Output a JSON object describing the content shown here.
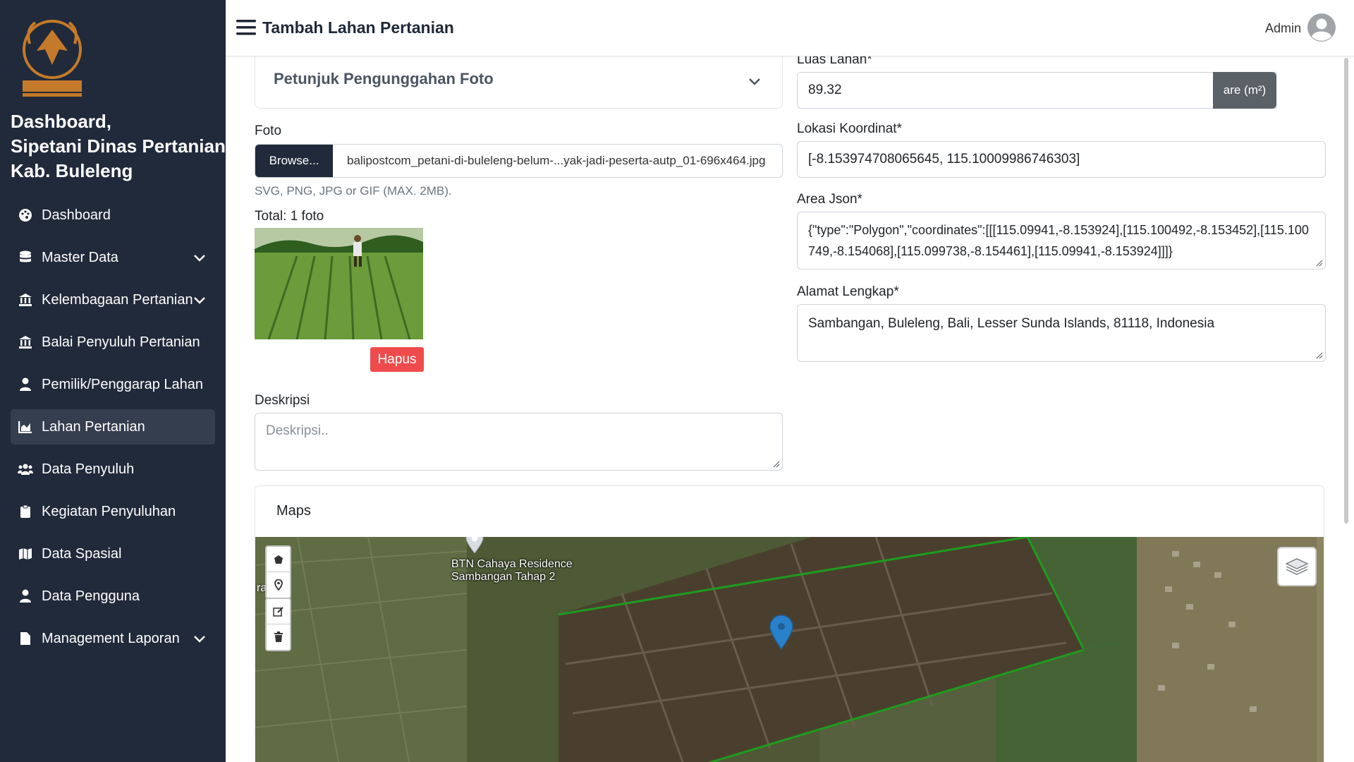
{
  "sidebar": {
    "brand_line1": "Dashboard,",
    "brand_line2": "Sipetani Dinas Pertanian",
    "brand_line3": "Kab. Buleleng",
    "items": [
      {
        "label": "Dashboard",
        "icon": "palette-icon"
      },
      {
        "label": "Master Data",
        "icon": "database-icon",
        "expandable": true
      },
      {
        "label": "Kelembagaan Pertanian",
        "icon": "institution-icon",
        "expandable": true
      },
      {
        "label": "Balai Penyuluh Pertanian",
        "icon": "institution-icon"
      },
      {
        "label": "Pemilik/Penggarap Lahan",
        "icon": "user-icon"
      },
      {
        "label": "Lahan Pertanian",
        "icon": "chart-area-icon",
        "active": true
      },
      {
        "label": "Data Penyuluh",
        "icon": "users-icon"
      },
      {
        "label": "Kegiatan Penyuluhan",
        "icon": "clipboard-icon"
      },
      {
        "label": "Data Spasial",
        "icon": "map-icon"
      },
      {
        "label": "Data Pengguna",
        "icon": "user-icon"
      },
      {
        "label": "Management Laporan",
        "icon": "file-icon",
        "expandable": true
      }
    ],
    "bg_color": "#212a3a",
    "active_color": "#353e4e"
  },
  "header": {
    "title": "Tambah Lahan Pertanian",
    "user": "Admin"
  },
  "form": {
    "accordion_label": "Petunjuk Pengunggahan Foto",
    "foto_label": "Foto",
    "browse_label": "Browse...",
    "file_name": "balipostcom_petani-di-buleleng-belum-...yak-jadi-peserta-autp_01-696x464.jpg",
    "file_hint": "SVG, PNG, JPG or GIF (MAX. 2MB).",
    "total_label": "Total: 1 foto",
    "hapus_label": "Hapus",
    "deskripsi_label": "Deskripsi",
    "deskripsi_placeholder": "Deskripsi..",
    "luas_label": "Luas Lahan*",
    "luas_value": "89.32",
    "luas_unit": "are (m²)",
    "koordinat_label": "Lokasi Koordinat*",
    "koordinat_value": "[-8.153974708065645, 115.10009986746303]",
    "area_label": "Area Json*",
    "area_value": "{\"type\":\"Polygon\",\"coordinates\":[[[115.09941,-8.153924],[115.100492,-8.153452],[115.100749,-8.154068],[115.099738,-8.154461],[115.09941,-8.153924]]]}",
    "alamat_label": "Alamat Lengkap*",
    "alamat_value": "Sambangan, Buleleng, Bali, Lesser Sunda Islands, 81118, Indonesia"
  },
  "maps": {
    "title": "Maps",
    "place_label_1": "BTN Cahaya Residence",
    "place_label_2": "Sambangan Tahap 2",
    "partial_label": "ra  rt",
    "polygon_color": "#1f9b1f",
    "marker_color": "#2a81cb"
  }
}
